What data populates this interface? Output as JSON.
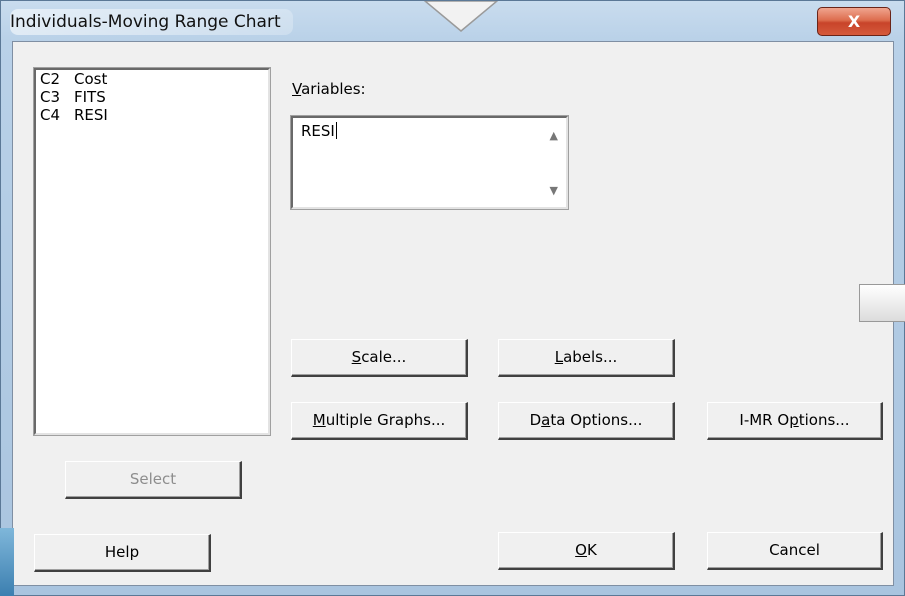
{
  "window": {
    "title": "Individuals-Moving Range Chart",
    "close_label": "X"
  },
  "variables_list": [
    {
      "col": "C2",
      "name": "Cost"
    },
    {
      "col": "C3",
      "name": "FITS"
    },
    {
      "col": "C4",
      "name": "RESI"
    }
  ],
  "variables": {
    "label_prefix": "",
    "label_mnemonic": "V",
    "label_rest": "ariables:",
    "value": "RESI"
  },
  "buttons": {
    "scale": {
      "mn": "S",
      "rest": "cale..."
    },
    "labels": {
      "mn": "L",
      "rest": "abels..."
    },
    "multiple_graphs": {
      "mn": "M",
      "rest": "ultiple Graphs..."
    },
    "data_options": {
      "pre": "D",
      "mn": "a",
      "rest": "ta Options..."
    },
    "imr_options": {
      "pre": "I-MR O",
      "mn": "p",
      "rest": "tions..."
    },
    "select": "Select",
    "help": "Help",
    "ok": {
      "mn": "O",
      "rest": "K"
    },
    "cancel": "Cancel"
  }
}
